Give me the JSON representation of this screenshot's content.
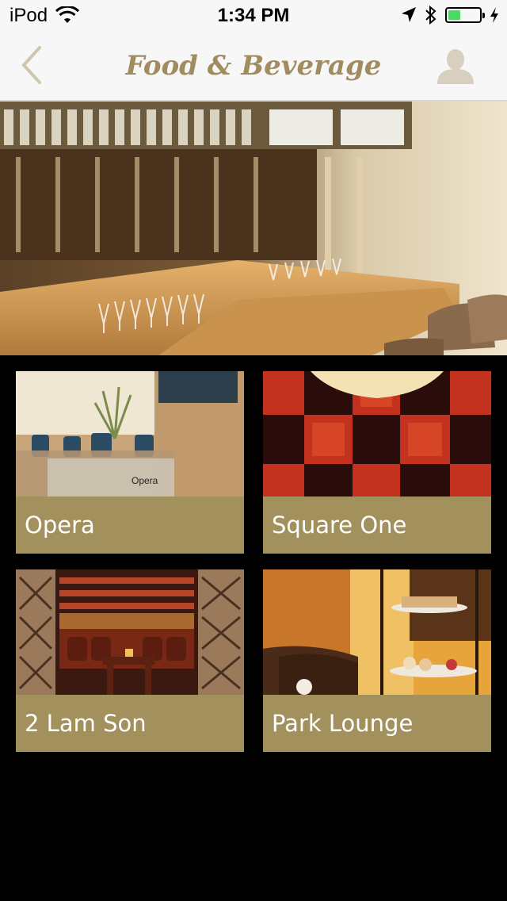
{
  "status_bar": {
    "carrier": "iPod",
    "time": "1:34 PM",
    "battery_level": 0.4,
    "icons": [
      "wifi-icon",
      "location-arrow-icon",
      "bluetooth-icon",
      "battery-icon",
      "charging-icon"
    ]
  },
  "nav": {
    "title": "Food & Beverage",
    "back_icon": "chevron-left-icon",
    "profile_icon": "user-icon",
    "accent_color": "#a08c5f"
  },
  "hero": {
    "image": "bar-interior-photo"
  },
  "venues": [
    {
      "name": "Opera",
      "photo": "opera-restaurant-photo",
      "sign_text": "Opera"
    },
    {
      "name": "Square One",
      "photo": "square-one-red-wall-photo"
    },
    {
      "name": "2 Lam Son",
      "photo": "lam-son-lounge-photo"
    },
    {
      "name": "Park Lounge",
      "photo": "park-lounge-afternoon-tea-photo"
    }
  ],
  "colors": {
    "tile_label_bg": "#a2905d",
    "background": "#000000",
    "nav_bg": "#f7f7f7"
  }
}
